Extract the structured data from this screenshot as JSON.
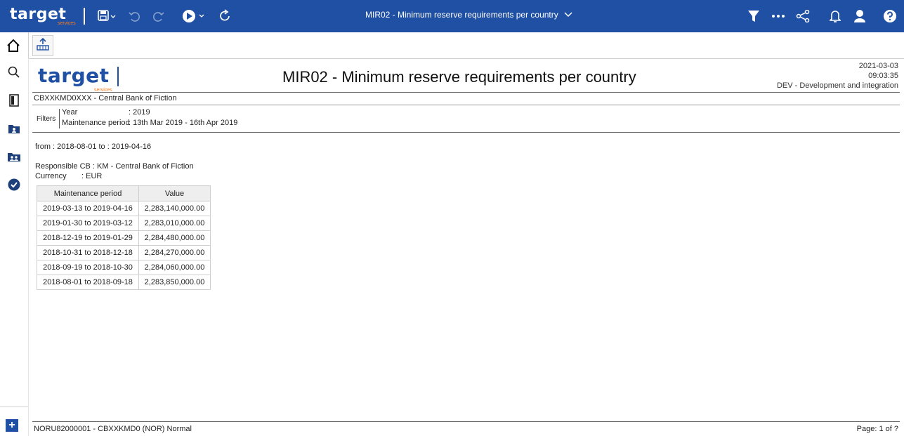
{
  "app": {
    "logo": "target",
    "logo_sub": "services"
  },
  "topbar": {
    "report_title": "MIR02 - Minimum reserve requirements per country"
  },
  "report": {
    "logo": "target",
    "logo_sub": "services",
    "title": "MIR02 - Minimum reserve requirements per country",
    "date": "2021-03-03",
    "time": "09:03:35",
    "environment": "DEV - Development and integration",
    "bank": "CBXXKMD0XXX - Central Bank of Fiction",
    "filters": {
      "label": "Filters",
      "year_label": "Year",
      "year_value": ": 2019",
      "period_label": "Maintenance period",
      "period_value": ": 13th Mar 2019 - 16th Apr 2019"
    },
    "range": "from : 2018-08-01  to : 2019-04-16",
    "responsible_cb": "Responsible CB : KM - Central Bank of Fiction",
    "currency_label": "Currency",
    "currency_value": ": EUR",
    "table": {
      "headers": [
        "Maintenance period",
        "Value"
      ],
      "rows": [
        [
          "2019-03-13 to 2019-04-16",
          "2,283,140,000.00"
        ],
        [
          "2019-01-30 to 2019-03-12",
          "2,283,010,000.00"
        ],
        [
          "2018-12-19 to 2019-01-29",
          "2,284,480,000.00"
        ],
        [
          "2018-10-31 to 2018-12-18",
          "2,284,270,000.00"
        ],
        [
          "2018-09-19 to 2018-10-30",
          "2,284,060,000.00"
        ],
        [
          "2018-08-01 to 2018-09-18",
          "2,283,850,000.00"
        ]
      ]
    },
    "footer_left": "NORU82000001 - CBXXKMD0 (NOR) Normal",
    "footer_right": "Page: 1 of ?"
  },
  "colors": {
    "primary": "#1f50a3",
    "accent": "#ff7a1a"
  },
  "icons": [
    "save-icon",
    "undo-icon",
    "redo-icon",
    "run-icon",
    "refresh-icon",
    "filter-icon",
    "more-icon",
    "share-icon",
    "bell-icon",
    "user-icon",
    "help-icon",
    "home-icon",
    "export-icon",
    "search-icon",
    "bookmark-icon",
    "folder-icon",
    "team-folder-icon",
    "check-icon",
    "add-icon"
  ]
}
